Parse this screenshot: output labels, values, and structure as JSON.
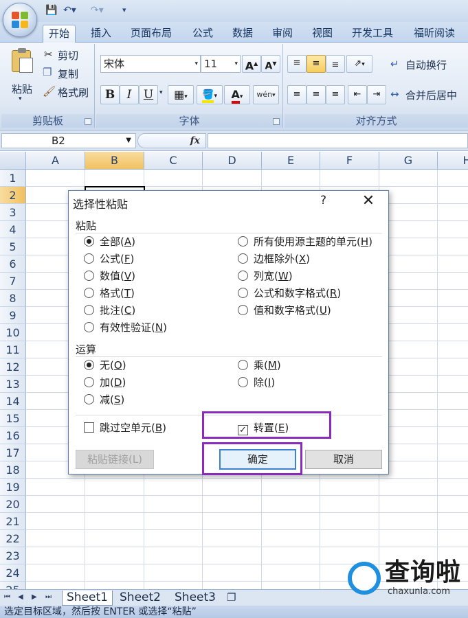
{
  "ribbon": {
    "tabs": [
      "开始",
      "插入",
      "页面布局",
      "公式",
      "数据",
      "审阅",
      "视图",
      "开发工具",
      "福昕阅读器"
    ],
    "clipboard": {
      "paste": "粘贴",
      "cut": "剪切",
      "copy": "复制",
      "format_painter": "格式刷",
      "group_label": "剪贴板"
    },
    "font": {
      "family": "宋体",
      "size": "11",
      "bold": "B",
      "italic": "I",
      "underline": "U",
      "font_color_glyph": "A",
      "phonetic_glyph": "wén",
      "group_label": "字体",
      "grow_glyph": "A",
      "shrink_glyph": "A"
    },
    "alignment": {
      "wrap_text": "自动换行",
      "merge_center": "合并后居中",
      "group_label": "对齐方式"
    }
  },
  "formula_bar": {
    "name_box": "B2",
    "fx": "fx",
    "value": ""
  },
  "sheet": {
    "columns": [
      "A",
      "B",
      "C",
      "D",
      "E",
      "F",
      "G",
      "H"
    ],
    "selected_column": "B",
    "selected_row": "2",
    "rows": [
      "1",
      "2",
      "3",
      "4",
      "5",
      "6",
      "7",
      "8",
      "9",
      "10",
      "11",
      "12",
      "13",
      "14",
      "15",
      "16",
      "17",
      "18",
      "19",
      "20",
      "21",
      "22",
      "23",
      "24",
      "25"
    ]
  },
  "sheet_tabs": [
    "Sheet1",
    "Sheet2",
    "Sheet3"
  ],
  "status_bar": "选定目标区域，然后按 ENTER 或选择“粘贴”",
  "dialog": {
    "title": "选择性粘贴",
    "help": "?",
    "paste_section": "粘贴",
    "paste_options_left": [
      {
        "label": "全部",
        "key": "A",
        "checked": true
      },
      {
        "label": "公式",
        "key": "F",
        "checked": false
      },
      {
        "label": "数值",
        "key": "V",
        "checked": false
      },
      {
        "label": "格式",
        "key": "T",
        "checked": false
      },
      {
        "label": "批注",
        "key": "C",
        "checked": false
      },
      {
        "label": "有效性验证",
        "key": "N",
        "checked": false
      }
    ],
    "paste_options_right": [
      {
        "label": "所有使用源主题的单元",
        "key": "H",
        "checked": false
      },
      {
        "label": "边框除外",
        "key": "X",
        "checked": false
      },
      {
        "label": "列宽",
        "key": "W",
        "checked": false
      },
      {
        "label": "公式和数字格式",
        "key": "R",
        "checked": false
      },
      {
        "label": "值和数字格式",
        "key": "U",
        "checked": false
      }
    ],
    "operation_section": "运算",
    "operation_left": [
      {
        "label": "无",
        "key": "O",
        "checked": true
      },
      {
        "label": "加",
        "key": "D",
        "checked": false
      },
      {
        "label": "减",
        "key": "S",
        "checked": false
      }
    ],
    "operation_right": [
      {
        "label": "乘",
        "key": "M",
        "checked": false
      },
      {
        "label": "除",
        "key": "I",
        "checked": false
      }
    ],
    "skip_blanks": {
      "label": "跳过空单元",
      "key": "B",
      "checked": false
    },
    "transpose": {
      "label": "转置",
      "key": "E",
      "checked": true
    },
    "paste_link": "粘贴链接(L)",
    "ok": "确定",
    "cancel": "取消"
  },
  "watermark": {
    "brand": "查询啦",
    "domain": "chaxunla.com"
  },
  "colors": {
    "highlight": "#8b2bbd",
    "selected_header": "#f1c15f",
    "ribbon_blue": "#c4d6ee"
  }
}
